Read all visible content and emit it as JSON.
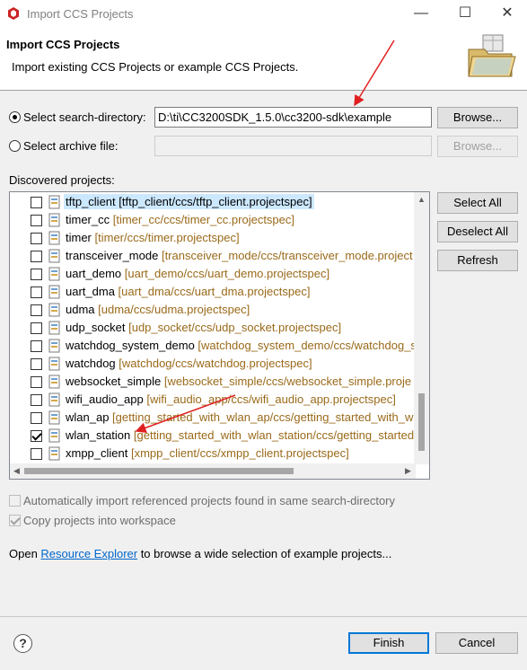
{
  "window": {
    "title": "Import CCS Projects",
    "minimize": "—",
    "maximize": "☐",
    "close": "✕"
  },
  "header": {
    "title": "Import CCS Projects",
    "description": "Import existing CCS Projects or example CCS Projects."
  },
  "source": {
    "search_dir_label": "Select search-directory:",
    "search_dir_value": "D:\\ti\\CC3200SDK_1.5.0\\cc3200-sdk\\example",
    "search_dir_selected": true,
    "browse_label": "Browse...",
    "archive_label": "Select archive file:",
    "archive_value": "",
    "archive_browse_label": "Browse..."
  },
  "discovered": {
    "label": "Discovered projects:",
    "projects": [
      {
        "name": "tftp_client",
        "path": "[tftp_client/ccs/tftp_client.projectspec]",
        "checked": false,
        "selected": true
      },
      {
        "name": "timer_cc",
        "path": "[timer_cc/ccs/timer_cc.projectspec]",
        "checked": false,
        "selected": false
      },
      {
        "name": "timer",
        "path": "[timer/ccs/timer.projectspec]",
        "checked": false,
        "selected": false
      },
      {
        "name": "transceiver_mode",
        "path": "[transceiver_mode/ccs/transceiver_mode.project",
        "checked": false,
        "selected": false
      },
      {
        "name": "uart_demo",
        "path": "[uart_demo/ccs/uart_demo.projectspec]",
        "checked": false,
        "selected": false
      },
      {
        "name": "uart_dma",
        "path": "[uart_dma/ccs/uart_dma.projectspec]",
        "checked": false,
        "selected": false
      },
      {
        "name": "udma",
        "path": "[udma/ccs/udma.projectspec]",
        "checked": false,
        "selected": false
      },
      {
        "name": "udp_socket",
        "path": "[udp_socket/ccs/udp_socket.projectspec]",
        "checked": false,
        "selected": false
      },
      {
        "name": "watchdog_system_demo",
        "path": "[watchdog_system_demo/ccs/watchdog_s",
        "checked": false,
        "selected": false
      },
      {
        "name": "watchdog",
        "path": "[watchdog/ccs/watchdog.projectspec]",
        "checked": false,
        "selected": false
      },
      {
        "name": "websocket_simple",
        "path": "[websocket_simple/ccs/websocket_simple.proje",
        "checked": false,
        "selected": false
      },
      {
        "name": "wifi_audio_app",
        "path": "[wifi_audio_app/ccs/wifi_audio_app.projectspec]",
        "checked": false,
        "selected": false
      },
      {
        "name": "wlan_ap",
        "path": "[getting_started_with_wlan_ap/ccs/getting_started_with_wla",
        "checked": false,
        "selected": false
      },
      {
        "name": "wlan_station",
        "path": "[getting_started_with_wlan_station/ccs/getting_started_",
        "checked": true,
        "selected": false
      },
      {
        "name": "xmpp_client",
        "path": "[xmpp_client/ccs/xmpp_client.projectspec]",
        "checked": false,
        "selected": false
      }
    ],
    "select_all": "Select All",
    "deselect_all": "Deselect All",
    "refresh": "Refresh"
  },
  "options": {
    "auto_import_label": "Automatically import referenced projects found in same search-directory",
    "auto_import_checked": false,
    "copy_label": "Copy projects into workspace",
    "copy_checked": true
  },
  "footer_text": {
    "before": "Open ",
    "link": "Resource Explorer",
    "after": " to browse a wide selection of example projects..."
  },
  "buttons": {
    "help": "?",
    "finish": "Finish",
    "cancel": "Cancel"
  },
  "colors": {
    "annotation_arrow": "#e02020",
    "selection": "#cce8ff",
    "path_text": "#9a6a1a",
    "link": "#0066cc"
  }
}
